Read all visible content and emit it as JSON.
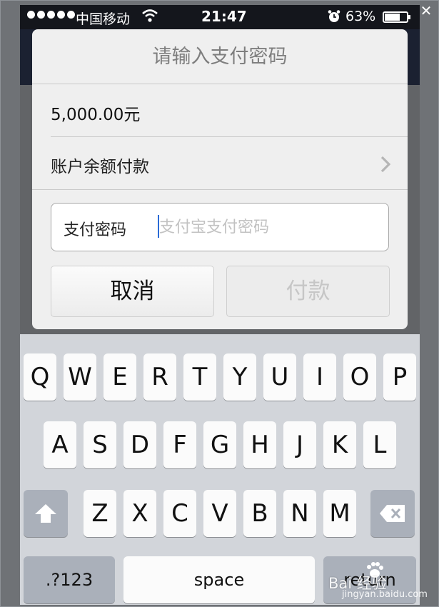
{
  "window": {
    "close_glyph": "✕"
  },
  "status_bar": {
    "carrier": "中国移动",
    "time": "21:47",
    "battery": "63%"
  },
  "dialog": {
    "title": "请输入支付密码",
    "amount": "5,000.00元",
    "pay_method": "账户余额付款",
    "password_label": "支付密码",
    "password_placeholder": "支付宝支付密码",
    "cancel_label": "取消",
    "pay_label": "付款"
  },
  "keyboard": {
    "row1": [
      "Q",
      "W",
      "E",
      "R",
      "T",
      "Y",
      "U",
      "I",
      "O",
      "P"
    ],
    "row2": [
      "A",
      "S",
      "D",
      "F",
      "G",
      "H",
      "J",
      "K",
      "L"
    ],
    "row3": [
      "Z",
      "X",
      "C",
      "V",
      "B",
      "N",
      "M"
    ],
    "numbers_label": ".?123",
    "space_label": "space",
    "return_label": "return"
  },
  "watermark": {
    "text": "Bai 经验",
    "sub": "jingyan.baidu.com"
  },
  "icons": [
    "signal-icon",
    "wifi-icon",
    "alarm-icon",
    "battery-icon",
    "chevron-right-icon",
    "shift-icon",
    "delete-icon",
    "close-icon"
  ]
}
